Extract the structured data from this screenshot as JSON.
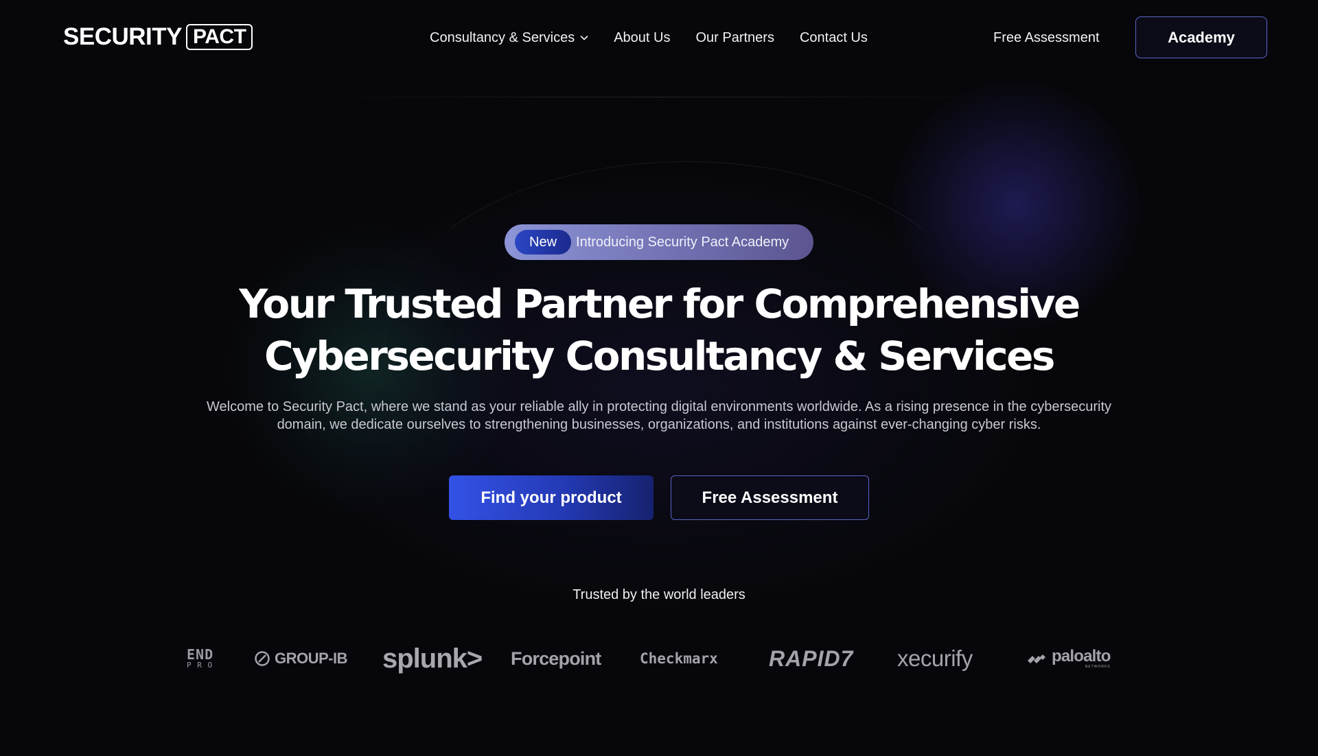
{
  "brand": {
    "logo_word": "SECURITY",
    "logo_boxed": "PACT"
  },
  "nav": {
    "items": [
      {
        "label": "Consultancy & Services",
        "has_dropdown": true,
        "icon": "chevron-down-icon"
      },
      {
        "label": "About Us"
      },
      {
        "label": "Our Partners"
      },
      {
        "label": "Contact Us"
      }
    ],
    "free_assessment": "Free Assessment",
    "academy": "Academy"
  },
  "hero": {
    "badge_tag": "New",
    "badge_text": "Introducing Security Pact Academy",
    "headline_line1": "Your Trusted Partner for Comprehensive",
    "headline_line2": "Cybersecurity Consultancy & Services",
    "subtitle_line1": "Welcome to Security Pact, where we stand as your reliable ally in protecting digital environments worldwide. As a rising presence in the cybersecurity",
    "subtitle_line2": "domain, we dedicate ourselves to strengthening businesses, organizations, and institutions against ever-changing cyber risks.",
    "primary_cta": "Find your product",
    "secondary_cta": "Free Assessment"
  },
  "partners": {
    "heading": "Trusted by the world leaders",
    "logos": [
      {
        "text_top": "END",
        "text_bottom": "P R O"
      },
      {
        "text": "GROUP-IB"
      },
      {
        "text": "splunk>"
      },
      {
        "text": "Forcepoint"
      },
      {
        "text": "Checkmarx"
      },
      {
        "text": "RAPID7"
      },
      {
        "text": "xecurify"
      },
      {
        "text": "paloalto",
        "subtext": "NETWORKS"
      }
    ]
  },
  "colors": {
    "background": "#07070b",
    "accent_blue": "#3352e6",
    "button_border": "#5b64c7",
    "badge_gradient_start": "#8c95d6",
    "muted_logo": "#a3a3aa"
  }
}
